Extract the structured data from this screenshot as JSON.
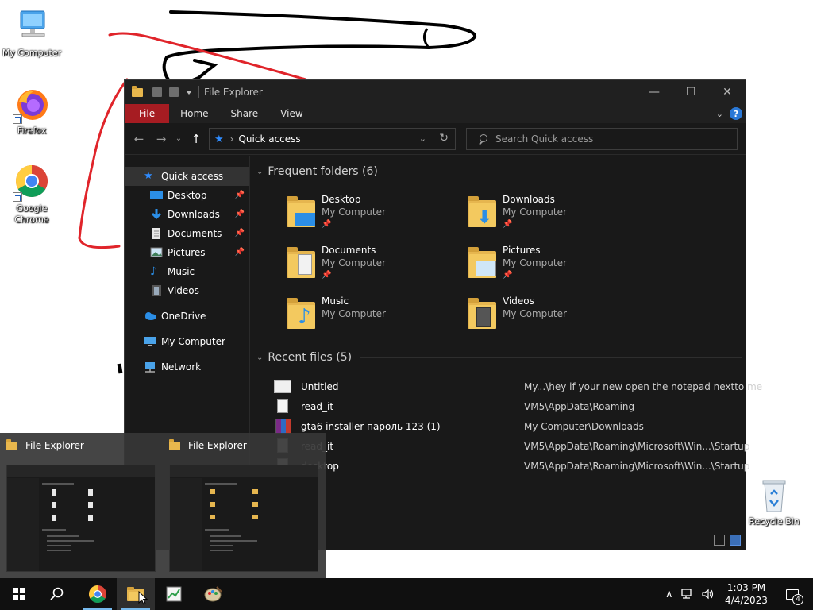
{
  "desktop": {
    "icons": [
      {
        "label": "My Computer"
      },
      {
        "label": "Firefox"
      },
      {
        "label": "Google Chrome"
      },
      {
        "label": "Recycle Bin"
      }
    ]
  },
  "window": {
    "title": "File Explorer",
    "ribbon_tabs": [
      "File",
      "Home",
      "Share",
      "View"
    ],
    "address": "Quick access",
    "search_placeholder": "Search Quick access",
    "nav": [
      {
        "label": "Quick access",
        "icon": "star-icon"
      },
      {
        "label": "Desktop",
        "icon": "desktop-icon",
        "pinned": true
      },
      {
        "label": "Downloads",
        "icon": "download-arrow-icon",
        "pinned": true
      },
      {
        "label": "Documents",
        "icon": "document-icon",
        "pinned": true
      },
      {
        "label": "Pictures",
        "icon": "picture-icon",
        "pinned": true
      },
      {
        "label": "Music",
        "icon": "music-note-icon"
      },
      {
        "label": "Videos",
        "icon": "film-icon"
      },
      {
        "label": "OneDrive",
        "icon": "cloud-icon"
      },
      {
        "label": "My Computer",
        "icon": "monitor-icon"
      },
      {
        "label": "Network",
        "icon": "network-icon"
      }
    ],
    "frequent_header": "Frequent folders (6)",
    "frequent": [
      {
        "name": "Desktop",
        "location": "My Computer",
        "pinned": true
      },
      {
        "name": "Downloads",
        "location": "My Computer",
        "pinned": true
      },
      {
        "name": "Documents",
        "location": "My Computer",
        "pinned": true
      },
      {
        "name": "Pictures",
        "location": "My Computer",
        "pinned": true
      },
      {
        "name": "Music",
        "location": "My Computer",
        "pinned": false
      },
      {
        "name": "Videos",
        "location": "My Computer",
        "pinned": false
      }
    ],
    "recent_header": "Recent files (5)",
    "recent": [
      {
        "name": "Untitled",
        "path": "My...\\hey if your new open the notepad nextto me"
      },
      {
        "name": "read_it",
        "path": "VM5\\AppData\\Roaming"
      },
      {
        "name": "gta6 installer пароль 123 (1)",
        "path": "My Computer\\Downloads"
      },
      {
        "name": "read_it",
        "path": "VM5\\AppData\\Roaming\\Microsoft\\Win...\\Startup"
      },
      {
        "name": "desktop",
        "path": "VM5\\AppData\\Roaming\\Microsoft\\Win...\\Startup"
      }
    ]
  },
  "thumbnails": [
    {
      "title": "File Explorer"
    },
    {
      "title": "File Explorer"
    }
  ],
  "taskbar": {
    "time": "1:03 PM",
    "date": "4/4/2023",
    "notification_count": "4"
  },
  "colors": {
    "file_tab": "#a61c22",
    "accent": "#2f8cff",
    "scribble_black": "#000000",
    "scribble_red": "#e0242a"
  }
}
